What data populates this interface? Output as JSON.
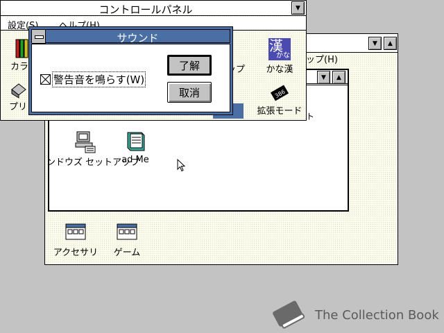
{
  "control_panel": {
    "title": "コントロールパネル",
    "menu": [
      "設定(S)",
      "ヘルプ(H)"
    ],
    "icons": [
      {
        "label": "カラー",
        "icon": "color-icon"
      },
      {
        "label": "かな漢",
        "icon": "kana-kanji-icon"
      },
      {
        "label": "プリンタ",
        "icon": "printer-icon"
      },
      {
        "label": "拡張モード",
        "icon": "extended-mode-icon"
      },
      {
        "label": "ップ",
        "icon": "partial-icon"
      },
      {
        "label": "ト",
        "icon": "partial-icon"
      }
    ],
    "icon_glyph_kanji": "漢",
    "icon_glyph_kana": "かな",
    "chip_text": "386"
  },
  "program_manager": {
    "menu_partial": "ップ(H)",
    "group": {
      "icons": [
        {
          "label": "ンドウズ セットアップ",
          "icon": "windows-setup-icon"
        },
        {
          "label": "ad Me",
          "icon": "read-me-icon"
        }
      ]
    },
    "groups": [
      {
        "label": "アクセサリ",
        "icon": "program-group-icon"
      },
      {
        "label": "ゲーム",
        "icon": "program-group-icon"
      }
    ]
  },
  "sound_dialog": {
    "title": "サウンド",
    "checkbox_label": "警告音を鳴らす(W)",
    "checkbox_checked": true,
    "ok_label": "了解",
    "cancel_label": "取消"
  },
  "watermark": {
    "text": "The Collection Book",
    "icon": "book-icon"
  },
  "colors": {
    "desktop": "#c3c3c3",
    "active_title": "#4a6fa5",
    "dither": "#fbfbee"
  }
}
